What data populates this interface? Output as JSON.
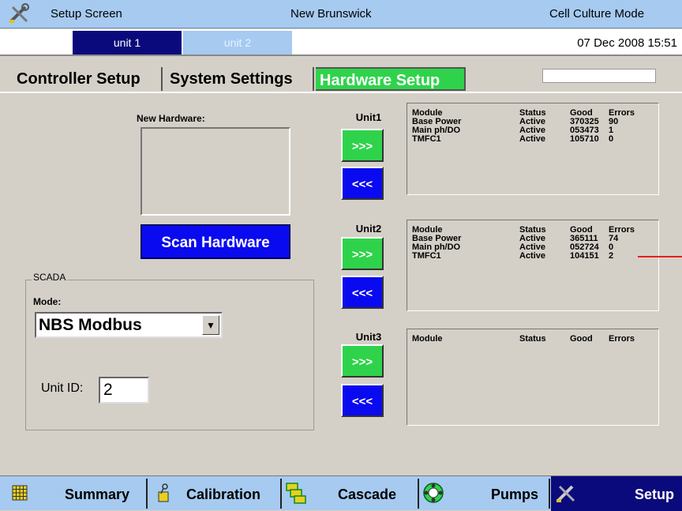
{
  "titlebar": {
    "screen": "Setup Screen",
    "brand": "New Brunswick",
    "mode": "Cell Culture Mode"
  },
  "units": {
    "unit1": "unit 1",
    "unit2": "unit 2",
    "datetime": "07 Dec 2008  15:51"
  },
  "tabs": {
    "controller": "Controller Setup",
    "system": "System Settings",
    "hardware": "Hardware Setup"
  },
  "new_hardware": {
    "label": "New Hardware:",
    "scan_button": "Scan Hardware"
  },
  "scada": {
    "legend": "SCADA",
    "mode_label": "Mode:",
    "mode_value": "NBS Modbus",
    "unit_id_label": "Unit ID:",
    "unit_id_value": "2"
  },
  "unit_panels": [
    {
      "label": "Unit1",
      "forward": ">>>",
      "back": "<<<",
      "headers": [
        "Module",
        "Status",
        "Good",
        "Errors"
      ],
      "rows": [
        [
          "Base Power",
          "Active",
          "370325",
          "90"
        ],
        [
          "Main ph/DO",
          "Active",
          "053473",
          "1"
        ],
        [
          "TMFC1",
          "Active",
          "105710",
          "0"
        ]
      ]
    },
    {
      "label": "Unit2",
      "forward": ">>>",
      "back": "<<<",
      "headers": [
        "Module",
        "Status",
        "Good",
        "Errors"
      ],
      "rows": [
        [
          "Base Power",
          "Active",
          "365111",
          "74"
        ],
        [
          "Main ph/DO",
          "Active",
          "052724",
          "0"
        ],
        [
          "TMFC1",
          "Active",
          "104151",
          "2"
        ]
      ]
    },
    {
      "label": "Unit3",
      "forward": ">>>",
      "back": "<<<",
      "headers": [
        "Module",
        "Status",
        "Good",
        "Errors"
      ],
      "rows": []
    }
  ],
  "bottom_nav": {
    "summary": "Summary",
    "calibration": "Calibration",
    "cascade": "Cascade",
    "pumps": "Pumps",
    "setup": "Setup"
  },
  "colors": {
    "accent_green": "#2fd34b",
    "accent_blue": "#0a0af0",
    "navy": "#0a0a7c",
    "light_blue": "#a6caf0"
  }
}
